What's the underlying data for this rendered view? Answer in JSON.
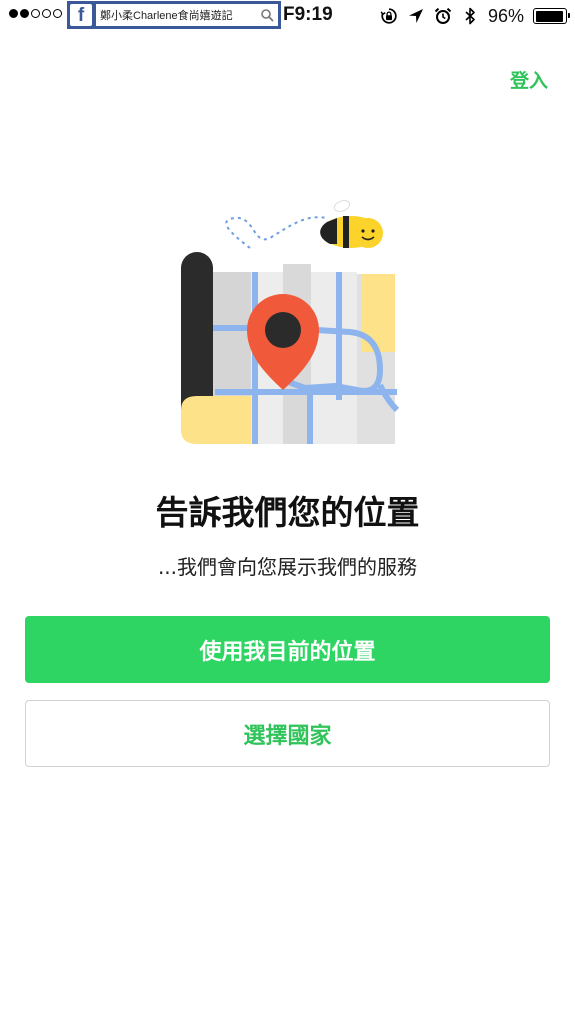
{
  "status_bar": {
    "signal": {
      "filled": 2,
      "total": 5
    },
    "facebook_search_text": "鄭小柔Charlene食尚嬉遊記",
    "time": "F9:19",
    "battery_percent": "96%",
    "battery_level": 0.96,
    "icons": [
      "lock-rotation-icon",
      "location-arrow-icon",
      "alarm-icon",
      "bluetooth-icon",
      "battery-icon"
    ]
  },
  "header": {
    "login_label": "登入"
  },
  "main": {
    "heading": "告訴我們您的位置",
    "subtitle": "...我們會向您展示我們的服務"
  },
  "buttons": {
    "use_location": "使用我目前的位置",
    "choose_country": "選擇國家"
  },
  "colors": {
    "accent_green": "#2fd563",
    "link_green": "#2fc35a",
    "pin_red": "#f05a3b",
    "map_yellow": "#fde28a",
    "road_blue": "#8db4ec",
    "bee_yellow": "#fcd32a",
    "facebook_blue": "#3b5998"
  }
}
